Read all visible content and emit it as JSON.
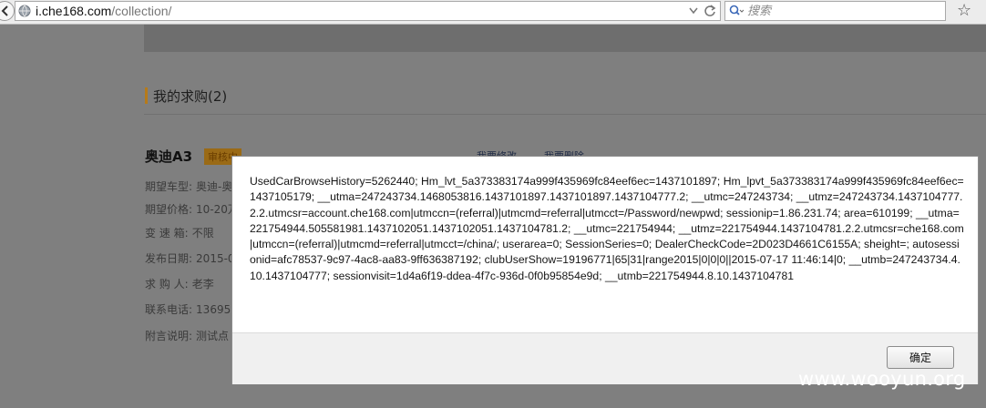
{
  "browser": {
    "url_domain": "i.che168.com",
    "url_path": "/collection/",
    "search_placeholder": "搜索"
  },
  "page": {
    "section_title": "我的求购(2)",
    "car_name": "奥迪A3",
    "status_badge": "审核中",
    "edit_link": "我要修改",
    "delete_link": "我要删除",
    "fields": [
      {
        "label": "期望车型:",
        "value": "奥迪-奥"
      },
      {
        "label": "期望价格:",
        "value": "10-20万"
      },
      {
        "label": "变 速 箱:",
        "value": "不限"
      },
      {
        "label": "发布日期:",
        "value": "2015-0"
      },
      {
        "label": "求 购 人:",
        "value": "老李"
      },
      {
        "label": "联系电话:",
        "value": "13695"
      },
      {
        "label": "附言说明:",
        "value": "测试点"
      }
    ]
  },
  "dialog": {
    "message": "UsedCarBrowseHistory=5262440; Hm_lvt_5a373383174a999f435969fc84eef6ec=1437101897; Hm_lpvt_5a373383174a999f435969fc84eef6ec=1437105179; __utma=247243734.1468053816.1437101897.1437101897.1437104777.2; __utmc=247243734; __utmz=247243734.1437104777.2.2.utmcsr=account.che168.com|utmccn=(referral)|utmcmd=referral|utmcct=/Password/newpwd; sessionip=1.86.231.74; area=610199; __utma=221754944.505581981.1437102051.1437102051.1437104781.2; __utmc=221754944; __utmz=221754944.1437104781.2.2.utmcsr=che168.com|utmccn=(referral)|utmcmd=referral|utmcct=/china/; userarea=0; SessionSeries=0; DealerCheckCode=2D023D4661C6155A; sheight=; autosessionid=afc78537-9c97-4ac8-aa83-9ff636387192; clubUserShow=19196771|65|31|range2015|0|0|0||2015-07-17 11:46:14|0; __utmb=247243734.4.10.1437104777; sessionvisit=1d4a6f19-ddea-4f7c-936d-0f0b95854e9d; __utmb=221754944.8.10.1437104781",
    "ok_label": "确定"
  },
  "watermark": "www.wooyun.org"
}
